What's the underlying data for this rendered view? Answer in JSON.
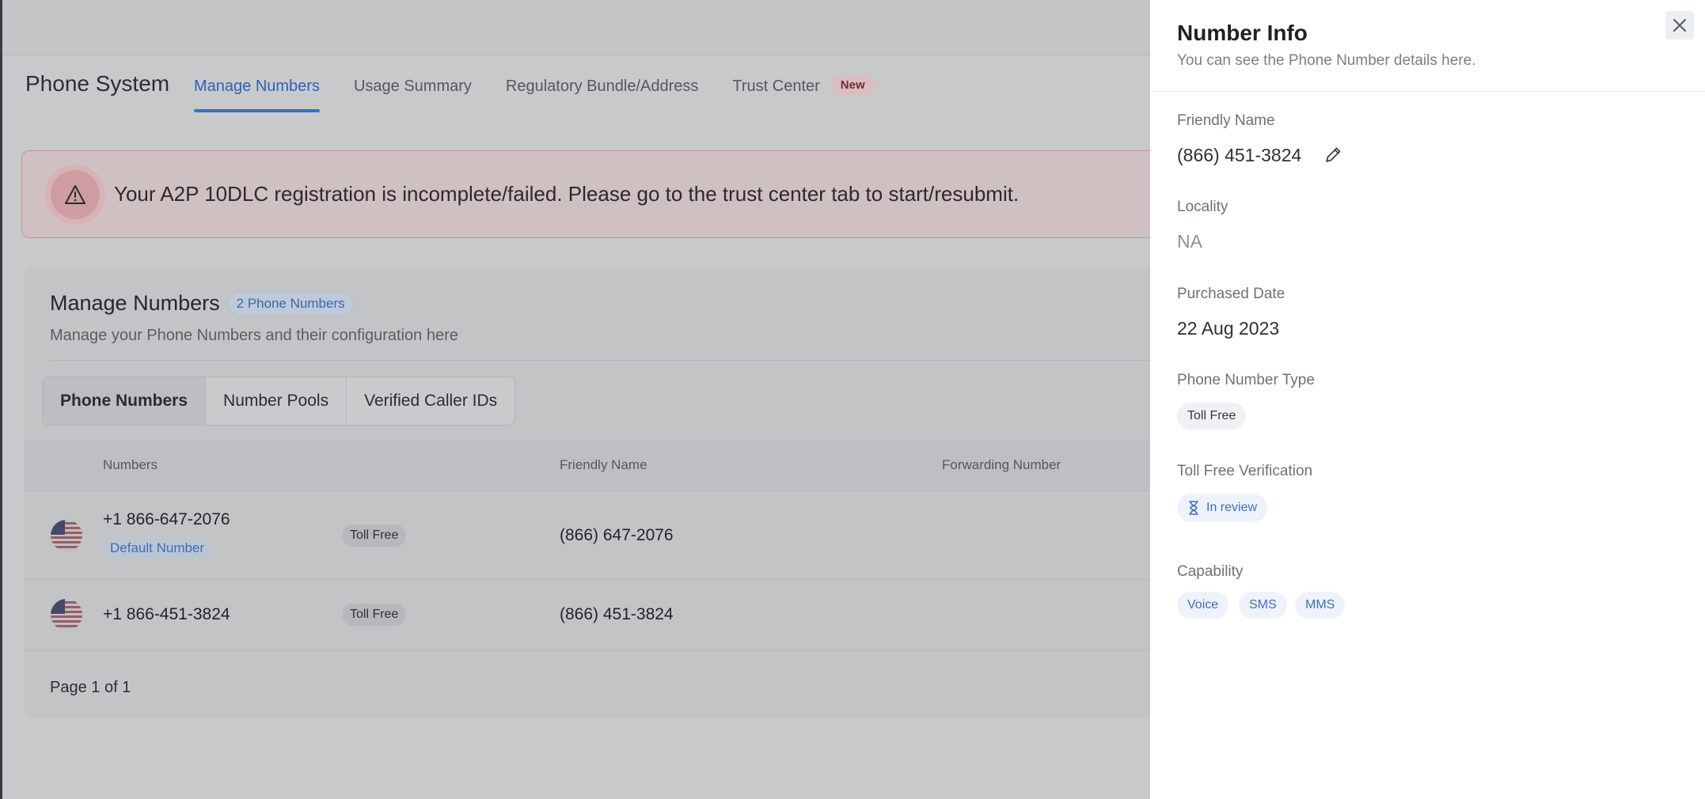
{
  "app": {
    "title": "Phone System"
  },
  "nav": {
    "tabs": [
      {
        "label": "Manage Numbers"
      },
      {
        "label": "Usage Summary"
      },
      {
        "label": "Regulatory Bundle/Address"
      },
      {
        "label": "Trust Center",
        "badge": "New"
      }
    ]
  },
  "alert": {
    "text": "Your A2P 10DLC registration is incomplete/failed. Please go to the trust center tab to start/resubmit."
  },
  "manage": {
    "title": "Manage Numbers",
    "count_badge": "2 Phone Numbers",
    "subtitle": "Manage your Phone Numbers and their configuration here",
    "segments": [
      "Phone Numbers",
      "Number Pools",
      "Verified Caller IDs"
    ],
    "columns": [
      "Numbers",
      "Friendly Name",
      "Forwarding Number"
    ],
    "rows": [
      {
        "number": "+1 866-647-2076",
        "badge": "Default Number",
        "type": "Toll Free",
        "friendly_name": "(866) 647-2076"
      },
      {
        "number": "+1 866-451-3824",
        "type": "Toll Free",
        "friendly_name": "(866) 451-3824"
      }
    ],
    "pagination": "Page 1 of 1"
  },
  "drawer": {
    "title": "Number Info",
    "subtitle": "You can see the Phone Number details here.",
    "friendly_name_label": "Friendly Name",
    "friendly_name": "(866) 451-3824",
    "locality_label": "Locality",
    "locality": "NA",
    "purchased_label": "Purchased Date",
    "purchased": "22 Aug 2023",
    "type_label": "Phone Number Type",
    "type": "Toll Free",
    "verification_label": "Toll Free Verification",
    "verification": "In review",
    "capability_label": "Capability",
    "capabilities": [
      "Voice",
      "SMS",
      "MMS"
    ]
  },
  "colors": {
    "accent": "#3a6fc7",
    "alert_border": "#cf8d92",
    "drawer_bg": "#ffffff"
  }
}
